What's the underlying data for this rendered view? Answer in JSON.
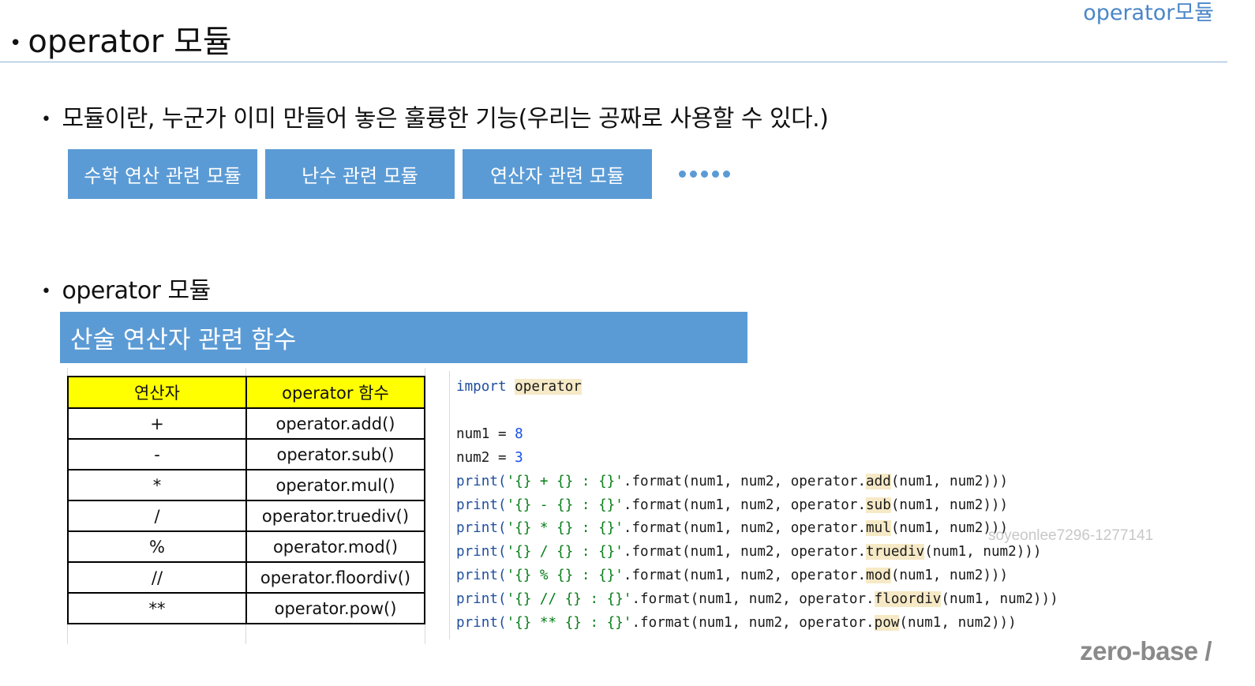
{
  "header": {
    "corner_label": "operator모듈",
    "title": "operator 모듈"
  },
  "intro": {
    "bullet": "모듈이란, 누군가 이미 만들어 놓은 훌륭한 기능(우리는 공짜로 사용할 수 있다.)",
    "boxes": [
      "수학 연산 관련 모듈",
      "난수 관련 모듈",
      "연산자 관련 모듈"
    ]
  },
  "section": {
    "bullet": "operator 모듈",
    "banner": "산술 연산자 관련 함수"
  },
  "table": {
    "headers": [
      "연산자",
      "operator 함수"
    ],
    "rows": [
      [
        "+",
        "operator.add()"
      ],
      [
        "-",
        "operator.sub()"
      ],
      [
        "*",
        "operator.mul()"
      ],
      [
        "/",
        "operator.truediv()"
      ],
      [
        "%",
        "operator.mod()"
      ],
      [
        "//",
        "operator.floordiv()"
      ],
      [
        "**",
        "operator.pow()"
      ]
    ]
  },
  "code": {
    "import_kw": "import",
    "import_mod": "operator",
    "assign1": "num1 = ",
    "val1": "8",
    "assign2": "num2 = ",
    "val2": "3",
    "print_lines": [
      {
        "pre": "print(",
        "str": "'{} + {} : {}'",
        "mid": ".format(num1, num2, operator.",
        "fn": "add",
        "post": "(num1, num2)))"
      },
      {
        "pre": "print(",
        "str": "'{} - {} : {}'",
        "mid": ".format(num1, num2, operator.",
        "fn": "sub",
        "post": "(num1, num2)))"
      },
      {
        "pre": "print(",
        "str": "'{} * {} : {}'",
        "mid": ".format(num1, num2, operator.",
        "fn": "mul",
        "post": "(num1, num2)))"
      },
      {
        "pre": "print(",
        "str": "'{} / {} : {}'",
        "mid": ".format(num1, num2, operator.",
        "fn": "truediv",
        "post": "(num1, num2)))"
      },
      {
        "pre": "print(",
        "str": "'{} % {} : {}'",
        "mid": ".format(num1, num2, operator.",
        "fn": "mod",
        "post": "(num1, num2)))"
      },
      {
        "pre": "print(",
        "str": "'{} // {} : {}'",
        "mid": ".format(num1, num2, operator.",
        "fn": "floordiv",
        "post": "(num1, num2)))"
      },
      {
        "pre": "print(",
        "str": "'{} ** {} : {}'",
        "mid": ".format(num1, num2, operator.",
        "fn": "pow",
        "post": "(num1, num2)))"
      }
    ]
  },
  "watermark": "soyeonlee7296-1277141",
  "brand": "zero-base /"
}
